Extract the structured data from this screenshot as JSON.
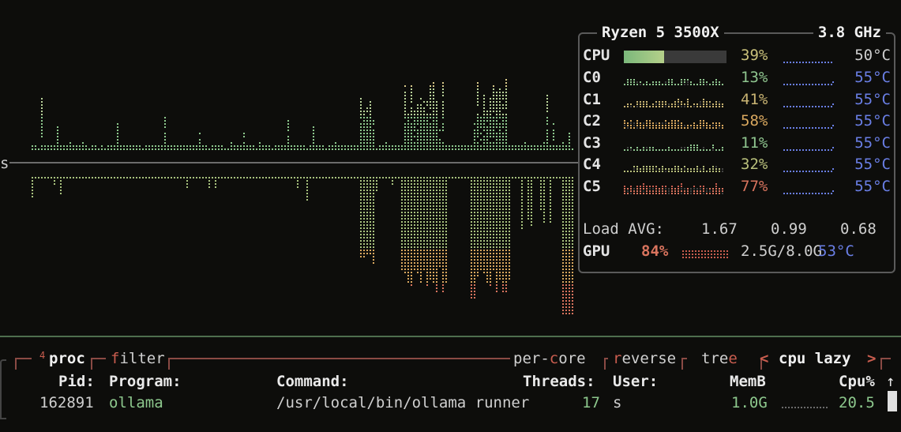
{
  "graph": {
    "left_label": "s"
  },
  "cpu_panel": {
    "model": "Ryzen 5 3500X",
    "freq": "3.8 GHz",
    "total": {
      "label": "CPU",
      "pct": "39%",
      "temp": "50°C",
      "usage": 0.39
    },
    "cores": [
      {
        "label": "C0",
        "pct": "13%",
        "temp": "55°C",
        "color": "#8fc58f"
      },
      {
        "label": "C1",
        "pct": "41%",
        "temp": "55°C",
        "color": "#c9b473"
      },
      {
        "label": "C2",
        "pct": "58%",
        "temp": "55°C",
        "color": "#d9a85f"
      },
      {
        "label": "C3",
        "pct": "11%",
        "temp": "55°C",
        "color": "#8fc58f"
      },
      {
        "label": "C4",
        "pct": "32%",
        "temp": "55°C",
        "color": "#b9c07c"
      },
      {
        "label": "C5",
        "pct": "77%",
        "temp": "55°C",
        "color": "#d9745e"
      }
    ],
    "load_label": "Load AVG:",
    "load": [
      "1.67",
      "0.99",
      "0.68"
    ],
    "gpu": {
      "label": "GPU",
      "pct": "84%",
      "mem": "2.5G/8.0G",
      "temp": "53°C"
    }
  },
  "proc_panel": {
    "index": "4",
    "title": "proc",
    "filter": "filter",
    "per_core": "per-core",
    "reverse": "reverse",
    "tree": "tree",
    "sort": "cpu lazy",
    "headers": [
      "Pid:",
      "Program:",
      "Command:",
      "Threads:",
      "User:",
      "MemB",
      "Cpu%"
    ],
    "rows": [
      {
        "pid": "162891",
        "program": "ollama",
        "command": "/usr/local/bin/ollama runner",
        "threads": "17",
        "user": "s",
        "mem": "1.0G",
        "cpu": "20.5"
      }
    ],
    "scroll_up": "↑"
  },
  "colors": {
    "accent_green": "#8dc88d",
    "accent_red": "#c95d4f",
    "temp_blue": "#6a7fe6",
    "border": "#5a5a5a"
  }
}
